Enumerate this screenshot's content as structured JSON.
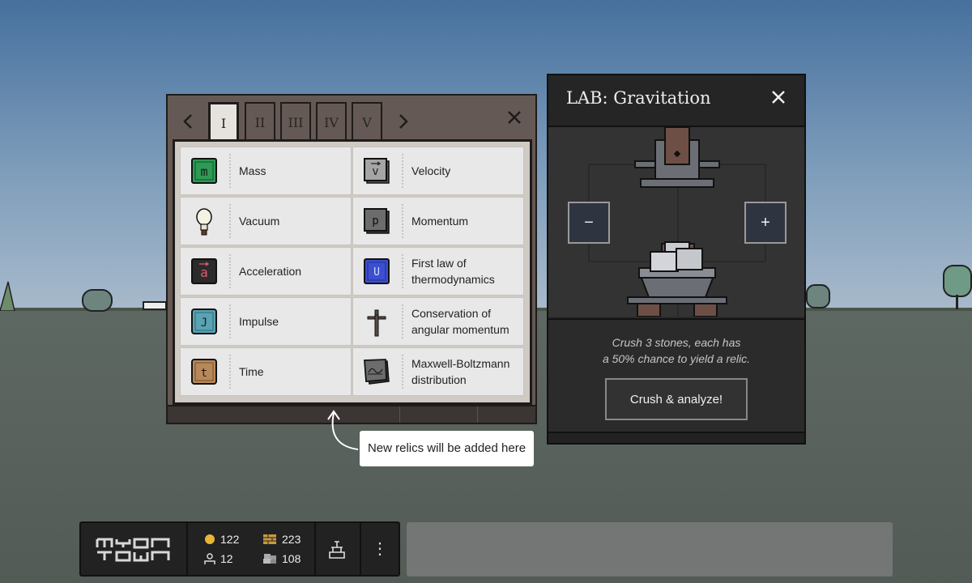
{
  "relic_book": {
    "tabs": [
      "I",
      "II",
      "III",
      "IV",
      "V"
    ],
    "active_tab": "I",
    "prev_label": "‹",
    "next_label": "›",
    "close_label": "✕",
    "relics": [
      {
        "name": "Mass",
        "icon": "mass-relic-icon",
        "color": "#2e9a55"
      },
      {
        "name": "Velocity",
        "icon": "velocity-relic-icon",
        "color": "#9a9a9a"
      },
      {
        "name": "Vacuum",
        "icon": "lightbulb-icon",
        "color": "#f2f2e4"
      },
      {
        "name": "Momentum",
        "icon": "momentum-relic-icon",
        "color": "#6c6c6c"
      },
      {
        "name": "Acceleration",
        "icon": "acceleration-relic-icon",
        "color": "#e05a78"
      },
      {
        "name": "First law of thermodynamics",
        "icon": "thermodynamics-relic-icon",
        "color": "#3c4fcf"
      },
      {
        "name": "Impulse",
        "icon": "impulse-relic-icon",
        "color": "#59a3b3"
      },
      {
        "name": "Conservation of angular momentum",
        "icon": "dagger-icon",
        "color": "#5a4a40"
      },
      {
        "name": "Time",
        "icon": "time-relic-icon",
        "color": "#b7895a"
      },
      {
        "name": "Maxwell-Boltzmann distribution",
        "icon": "distribution-relic-icon",
        "color": "#6c6c6c"
      }
    ],
    "tooltip": "New relics will be added here"
  },
  "lab": {
    "title": "LAB: Gravitation",
    "close_label": "✕",
    "minus_label": "−",
    "plus_label": "+",
    "description_line1": "Crush 3 stones, each has",
    "description_line2": "a 50% chance to yield a relic.",
    "action_label": "Crush & analyze!"
  },
  "hud": {
    "logo_text": "MYON TOWN",
    "coins": "122",
    "population": "12",
    "bricks": "223",
    "stone": "108",
    "menu_label": "⋮"
  },
  "colors": {
    "sky": "#5a80a8",
    "panel_brown": "#645954",
    "lab_dark": "#2a2a2a"
  }
}
